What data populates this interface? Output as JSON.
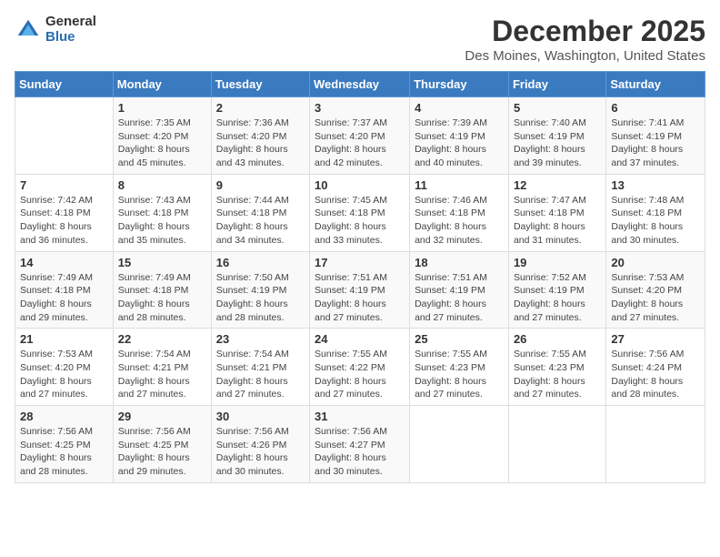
{
  "logo": {
    "general": "General",
    "blue": "Blue"
  },
  "title": "December 2025",
  "subtitle": "Des Moines, Washington, United States",
  "weekdays": [
    "Sunday",
    "Monday",
    "Tuesday",
    "Wednesday",
    "Thursday",
    "Friday",
    "Saturday"
  ],
  "weeks": [
    [
      {
        "day": "",
        "sunrise": "",
        "sunset": "",
        "daylight": ""
      },
      {
        "day": "1",
        "sunrise": "Sunrise: 7:35 AM",
        "sunset": "Sunset: 4:20 PM",
        "daylight": "Daylight: 8 hours and 45 minutes."
      },
      {
        "day": "2",
        "sunrise": "Sunrise: 7:36 AM",
        "sunset": "Sunset: 4:20 PM",
        "daylight": "Daylight: 8 hours and 43 minutes."
      },
      {
        "day": "3",
        "sunrise": "Sunrise: 7:37 AM",
        "sunset": "Sunset: 4:20 PM",
        "daylight": "Daylight: 8 hours and 42 minutes."
      },
      {
        "day": "4",
        "sunrise": "Sunrise: 7:39 AM",
        "sunset": "Sunset: 4:19 PM",
        "daylight": "Daylight: 8 hours and 40 minutes."
      },
      {
        "day": "5",
        "sunrise": "Sunrise: 7:40 AM",
        "sunset": "Sunset: 4:19 PM",
        "daylight": "Daylight: 8 hours and 39 minutes."
      },
      {
        "day": "6",
        "sunrise": "Sunrise: 7:41 AM",
        "sunset": "Sunset: 4:19 PM",
        "daylight": "Daylight: 8 hours and 37 minutes."
      }
    ],
    [
      {
        "day": "7",
        "sunrise": "Sunrise: 7:42 AM",
        "sunset": "Sunset: 4:18 PM",
        "daylight": "Daylight: 8 hours and 36 minutes."
      },
      {
        "day": "8",
        "sunrise": "Sunrise: 7:43 AM",
        "sunset": "Sunset: 4:18 PM",
        "daylight": "Daylight: 8 hours and 35 minutes."
      },
      {
        "day": "9",
        "sunrise": "Sunrise: 7:44 AM",
        "sunset": "Sunset: 4:18 PM",
        "daylight": "Daylight: 8 hours and 34 minutes."
      },
      {
        "day": "10",
        "sunrise": "Sunrise: 7:45 AM",
        "sunset": "Sunset: 4:18 PM",
        "daylight": "Daylight: 8 hours and 33 minutes."
      },
      {
        "day": "11",
        "sunrise": "Sunrise: 7:46 AM",
        "sunset": "Sunset: 4:18 PM",
        "daylight": "Daylight: 8 hours and 32 minutes."
      },
      {
        "day": "12",
        "sunrise": "Sunrise: 7:47 AM",
        "sunset": "Sunset: 4:18 PM",
        "daylight": "Daylight: 8 hours and 31 minutes."
      },
      {
        "day": "13",
        "sunrise": "Sunrise: 7:48 AM",
        "sunset": "Sunset: 4:18 PM",
        "daylight": "Daylight: 8 hours and 30 minutes."
      }
    ],
    [
      {
        "day": "14",
        "sunrise": "Sunrise: 7:49 AM",
        "sunset": "Sunset: 4:18 PM",
        "daylight": "Daylight: 8 hours and 29 minutes."
      },
      {
        "day": "15",
        "sunrise": "Sunrise: 7:49 AM",
        "sunset": "Sunset: 4:18 PM",
        "daylight": "Daylight: 8 hours and 28 minutes."
      },
      {
        "day": "16",
        "sunrise": "Sunrise: 7:50 AM",
        "sunset": "Sunset: 4:19 PM",
        "daylight": "Daylight: 8 hours and 28 minutes."
      },
      {
        "day": "17",
        "sunrise": "Sunrise: 7:51 AM",
        "sunset": "Sunset: 4:19 PM",
        "daylight": "Daylight: 8 hours and 27 minutes."
      },
      {
        "day": "18",
        "sunrise": "Sunrise: 7:51 AM",
        "sunset": "Sunset: 4:19 PM",
        "daylight": "Daylight: 8 hours and 27 minutes."
      },
      {
        "day": "19",
        "sunrise": "Sunrise: 7:52 AM",
        "sunset": "Sunset: 4:19 PM",
        "daylight": "Daylight: 8 hours and 27 minutes."
      },
      {
        "day": "20",
        "sunrise": "Sunrise: 7:53 AM",
        "sunset": "Sunset: 4:20 PM",
        "daylight": "Daylight: 8 hours and 27 minutes."
      }
    ],
    [
      {
        "day": "21",
        "sunrise": "Sunrise: 7:53 AM",
        "sunset": "Sunset: 4:20 PM",
        "daylight": "Daylight: 8 hours and 27 minutes."
      },
      {
        "day": "22",
        "sunrise": "Sunrise: 7:54 AM",
        "sunset": "Sunset: 4:21 PM",
        "daylight": "Daylight: 8 hours and 27 minutes."
      },
      {
        "day": "23",
        "sunrise": "Sunrise: 7:54 AM",
        "sunset": "Sunset: 4:21 PM",
        "daylight": "Daylight: 8 hours and 27 minutes."
      },
      {
        "day": "24",
        "sunrise": "Sunrise: 7:55 AM",
        "sunset": "Sunset: 4:22 PM",
        "daylight": "Daylight: 8 hours and 27 minutes."
      },
      {
        "day": "25",
        "sunrise": "Sunrise: 7:55 AM",
        "sunset": "Sunset: 4:23 PM",
        "daylight": "Daylight: 8 hours and 27 minutes."
      },
      {
        "day": "26",
        "sunrise": "Sunrise: 7:55 AM",
        "sunset": "Sunset: 4:23 PM",
        "daylight": "Daylight: 8 hours and 27 minutes."
      },
      {
        "day": "27",
        "sunrise": "Sunrise: 7:56 AM",
        "sunset": "Sunset: 4:24 PM",
        "daylight": "Daylight: 8 hours and 28 minutes."
      }
    ],
    [
      {
        "day": "28",
        "sunrise": "Sunrise: 7:56 AM",
        "sunset": "Sunset: 4:25 PM",
        "daylight": "Daylight: 8 hours and 28 minutes."
      },
      {
        "day": "29",
        "sunrise": "Sunrise: 7:56 AM",
        "sunset": "Sunset: 4:25 PM",
        "daylight": "Daylight: 8 hours and 29 minutes."
      },
      {
        "day": "30",
        "sunrise": "Sunrise: 7:56 AM",
        "sunset": "Sunset: 4:26 PM",
        "daylight": "Daylight: 8 hours and 30 minutes."
      },
      {
        "day": "31",
        "sunrise": "Sunrise: 7:56 AM",
        "sunset": "Sunset: 4:27 PM",
        "daylight": "Daylight: 8 hours and 30 minutes."
      },
      {
        "day": "",
        "sunrise": "",
        "sunset": "",
        "daylight": ""
      },
      {
        "day": "",
        "sunrise": "",
        "sunset": "",
        "daylight": ""
      },
      {
        "day": "",
        "sunrise": "",
        "sunset": "",
        "daylight": ""
      }
    ]
  ]
}
